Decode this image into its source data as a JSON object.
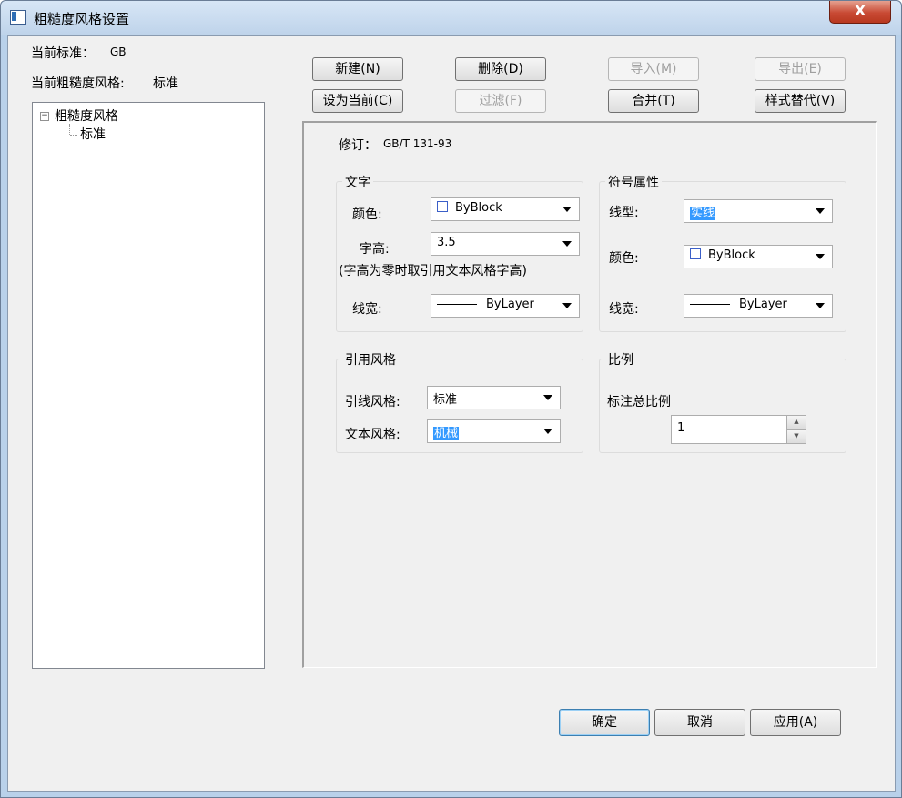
{
  "window": {
    "title": "粗糙度风格设置",
    "close_label": "X"
  },
  "left": {
    "current_standard_label": "当前标准：",
    "current_standard_value": "GB",
    "current_style_label": "当前粗糙度风格:",
    "current_style_value": "标准",
    "tree": {
      "root": "粗糙度风格",
      "expand_glyph": "−",
      "children": [
        "标准"
      ]
    }
  },
  "toolbar": {
    "new": "新建(N)",
    "delete": "删除(D)",
    "import": "导入(M)",
    "export": "导出(E)",
    "set_current": "设为当前(C)",
    "filter": "过滤(F)",
    "merge": "合并(T)",
    "replace": "样式替代(V)"
  },
  "panel": {
    "revision_label": "修订：",
    "revision_value": "GB/T 131-93",
    "text_group": {
      "title": "文字",
      "color_label": "颜色:",
      "color_value": "ByBlock",
      "height_label": "字高:",
      "height_value": "3.5",
      "height_note": "(字高为零时取引用文本风格字高)",
      "linewidth_label": "线宽:",
      "linewidth_value": "ByLayer"
    },
    "symbol_group": {
      "title": "符号属性",
      "linetype_label": "线型:",
      "linetype_value": "实线",
      "color_label": "颜色:",
      "color_value": "ByBlock",
      "linewidth_label": "线宽:",
      "linewidth_value": "ByLayer"
    },
    "ref_group": {
      "title": "引用风格",
      "leader_label": "引线风格:",
      "leader_value": "标准",
      "text_style_label": "文本风格:",
      "text_style_value": "机械"
    },
    "scale_group": {
      "title": "比例",
      "total_scale_label": "标注总比例",
      "total_scale_value": "1"
    }
  },
  "footer": {
    "ok": "确定",
    "cancel": "取消",
    "apply": "应用(A)"
  }
}
